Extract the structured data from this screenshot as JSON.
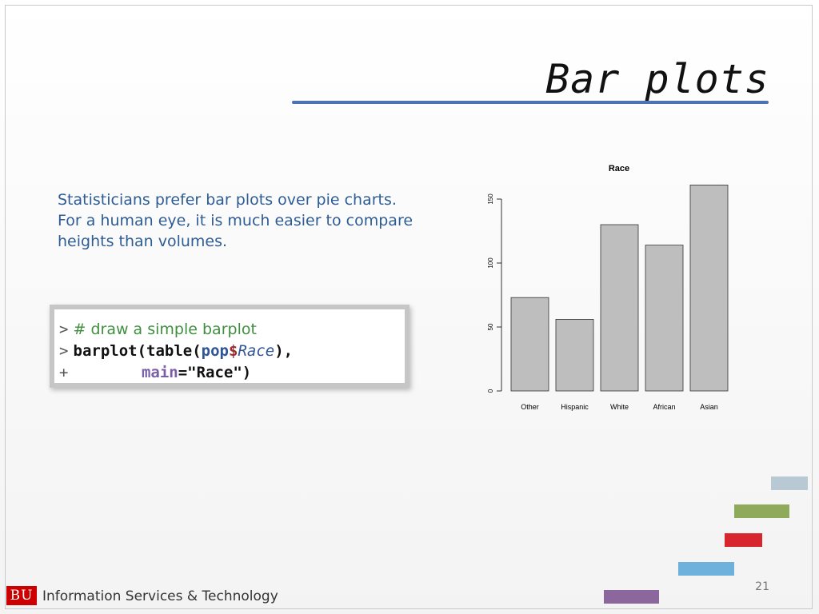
{
  "slide": {
    "title": "Bar plots",
    "body_lines": [
      "Statisticians prefer bar plots over pie charts.",
      "For a human eye, it is much easier to compare",
      "heights than volumes."
    ],
    "code": {
      "line1_prompt": ">",
      "line1_comment": "# draw a simple barplot",
      "line2_prompt": ">",
      "line2_func": "barplot(table(",
      "line2_var": "pop",
      "line2_dollar": "$",
      "line2_field": "Race",
      "line2_end": "),",
      "line3_prompt": "+",
      "line3_indent": "        ",
      "line3_arg": "main",
      "line3_rest": "=\"Race\")"
    },
    "footer": {
      "logo_text": "BU",
      "org_name": "Information Services & Technology"
    },
    "page_number": "21"
  },
  "chart_data": {
    "type": "bar",
    "title": "Race",
    "categories": [
      "Other",
      "Hispanic",
      "White",
      "African",
      "Asian"
    ],
    "values": [
      73,
      56,
      130,
      114,
      161
    ],
    "ylim": [
      0,
      170
    ],
    "yticks": [
      0,
      50,
      100,
      150
    ],
    "xlabel": "",
    "ylabel": "",
    "bar_color": "#bebebe",
    "grid": false
  },
  "colors": {
    "title_rule": "#4a73b8",
    "body_text": "#2e5c94",
    "comment": "#3f8f3f",
    "deco_bars": [
      "#b8c9d4",
      "#8faa5a",
      "#d8262e",
      "#6fb1dd",
      "#8b679e"
    ]
  }
}
